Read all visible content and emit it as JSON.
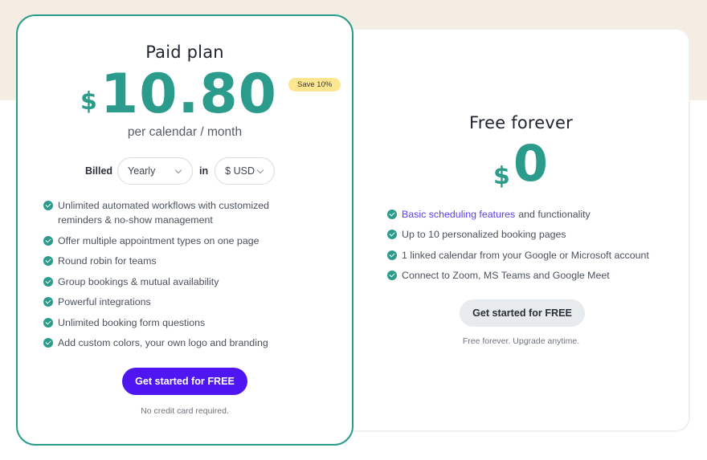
{
  "colors": {
    "accent_teal": "#2b9c8b",
    "primary_button": "#5016f2",
    "badge_yellow": "#fde68f",
    "link_purple": "#5b3ff0",
    "page_band": "#f5ede4"
  },
  "paid_plan": {
    "title": "Paid plan",
    "currency_symbol": "$",
    "price": "10.80",
    "badge": "Save 10%",
    "period": "per calendar / month",
    "billing": {
      "billed_label": "Billed",
      "frequency_selected": "Yearly",
      "in_label": "in",
      "currency_selected": "$ USD"
    },
    "features": [
      "Unlimited automated workflows with customized reminders & no-show management",
      "Offer multiple appointment types on one page",
      "Round robin for teams",
      "Group bookings & mutual availability",
      "Powerful integrations",
      "Unlimited booking form questions",
      "Add custom colors, your own logo and branding"
    ],
    "cta": "Get started for FREE",
    "note": "No credit card required."
  },
  "free_plan": {
    "title": "Free forever",
    "currency_symbol": "$",
    "price": "0",
    "features": [
      {
        "link": "Basic scheduling features",
        "text": "and functionality"
      },
      {
        "text": "Up to 10 personalized booking pages"
      },
      {
        "text": "1 linked calendar from your Google or Microsoft account"
      },
      {
        "text": "Connect to Zoom, MS Teams and Google Meet"
      }
    ],
    "cta": "Get started for FREE",
    "note": "Free forever. Upgrade anytime."
  },
  "icons": {
    "feature_bullet": "check-circle-icon",
    "select_arrow": "chevron-down-icon"
  }
}
